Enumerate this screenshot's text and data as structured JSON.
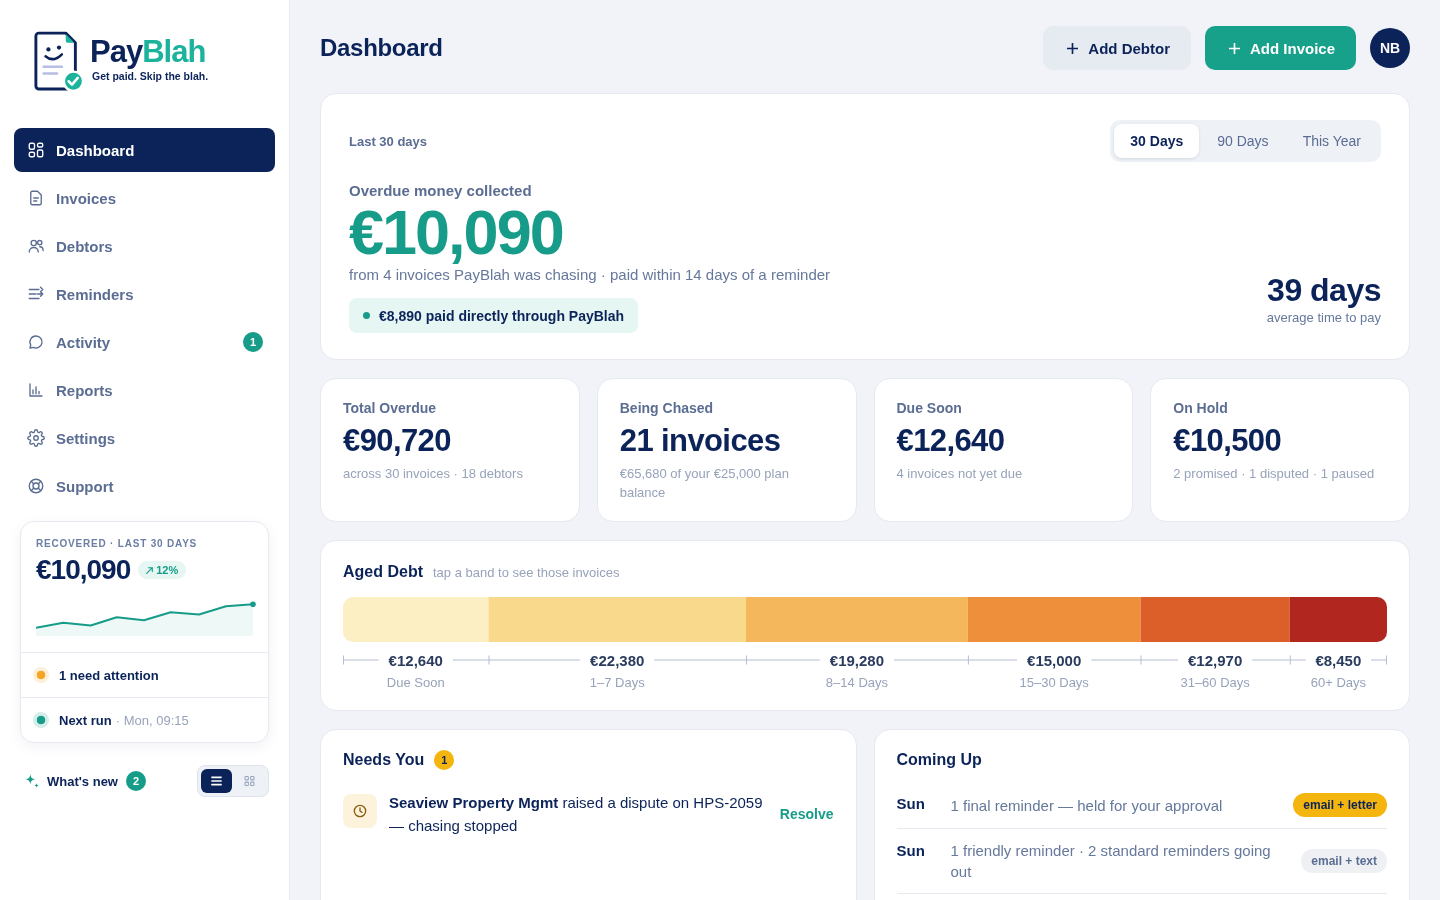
{
  "sidebar": {
    "logo": {
      "name_parts": [
        "Pay",
        "Blah"
      ],
      "tagline": "Get paid. Skip the blah."
    },
    "nav": [
      {
        "label": "Dashboard",
        "selected": true
      },
      {
        "label": "Invoices",
        "selected": false
      },
      {
        "label": "Debtors",
        "selected": false
      },
      {
        "label": "Reminders",
        "selected": false
      },
      {
        "label": "Activity",
        "selected": false,
        "badge": "1"
      },
      {
        "label": "Reports",
        "selected": false
      },
      {
        "label": "Settings",
        "selected": false
      },
      {
        "label": "Support",
        "selected": false
      }
    ],
    "recovered_card": {
      "label": "RECOVERED · LAST 30 DAYS",
      "amount": "€10,090",
      "change": "12%",
      "rows": [
        {
          "text": "1 need attention",
          "color": "#f5a524"
        },
        {
          "text": "Next run",
          "detail": "· Mon, 09:15",
          "color": "#169c88"
        }
      ]
    },
    "whats_new": {
      "label": "What's new",
      "badge": "2"
    },
    "view_toggle": [
      {
        "selected": true
      },
      {
        "selected": false
      }
    ]
  },
  "header": {
    "title": "Dashboard",
    "buttons": [
      {
        "label": "Add Debtor",
        "kind": "secondary"
      },
      {
        "label": "Add Invoice",
        "kind": "primary"
      }
    ],
    "avatar": "NB"
  },
  "summary": {
    "period_label": "Last 30 days",
    "periods": [
      {
        "label": "30 Days",
        "selected": true
      },
      {
        "label": "90 Days",
        "selected": false
      },
      {
        "label": "This Year",
        "selected": false
      }
    ],
    "headline_label": "Overdue money collected",
    "amount": "€10,090",
    "detail": "from 4 invoices PayBlah was chasing · paid within 14 days of a reminder",
    "direct_payment": "€8,890 paid directly through PayBlah",
    "average": {
      "value": "39 days",
      "label": "average time to pay"
    }
  },
  "stats": [
    {
      "label": "Total Overdue",
      "value": "€90,720",
      "detail": "across 30 invoices · 18 debtors"
    },
    {
      "label": "Being Chased",
      "value": "21 invoices",
      "detail": "€65,680 of your €25,000 plan balance"
    },
    {
      "label": "Due Soon",
      "value": "€12,640",
      "detail": "4 invoices not yet due"
    },
    {
      "label": "On Hold",
      "value": "€10,500",
      "detail": "2 promised · 1 disputed · 1 paused"
    }
  ],
  "aged_debt": {
    "title": "Aged Debt",
    "hint": "tap a band to see those invoices",
    "bands": [
      {
        "amount": "€12,640",
        "range": "Due Soon",
        "color": "#fcefc4"
      },
      {
        "amount": "€22,380",
        "range": "1–7 Days",
        "color": "#f9d98c"
      },
      {
        "amount": "€19,280",
        "range": "8–14 Days",
        "color": "#f5b75c"
      },
      {
        "amount": "€15,000",
        "range": "15–30 Days",
        "color": "#ee8f3b"
      },
      {
        "amount": "€12,970",
        "range": "31–60 Days",
        "color": "#dc5f2a"
      },
      {
        "amount": "€8,450",
        "range": "60+ Days",
        "color": "#b1261f"
      }
    ]
  },
  "needs_you": {
    "title": "Needs You",
    "count": "1",
    "items": [
      {
        "text": "**Seaview Property Mgmt** raised a dispute on HPS-2059 — chasing stopped",
        "action": "Resolve"
      }
    ]
  },
  "coming_up": {
    "title": "Coming Up",
    "items": [
      {
        "day": "Sun",
        "text": "1 final reminder — held for your approval",
        "channel": "email + letter",
        "highlighted": true
      },
      {
        "day": "Sun",
        "text": "1 friendly reminder · 2 standard reminders going out",
        "channel": "email + text",
        "highlighted": false
      }
    ]
  }
}
